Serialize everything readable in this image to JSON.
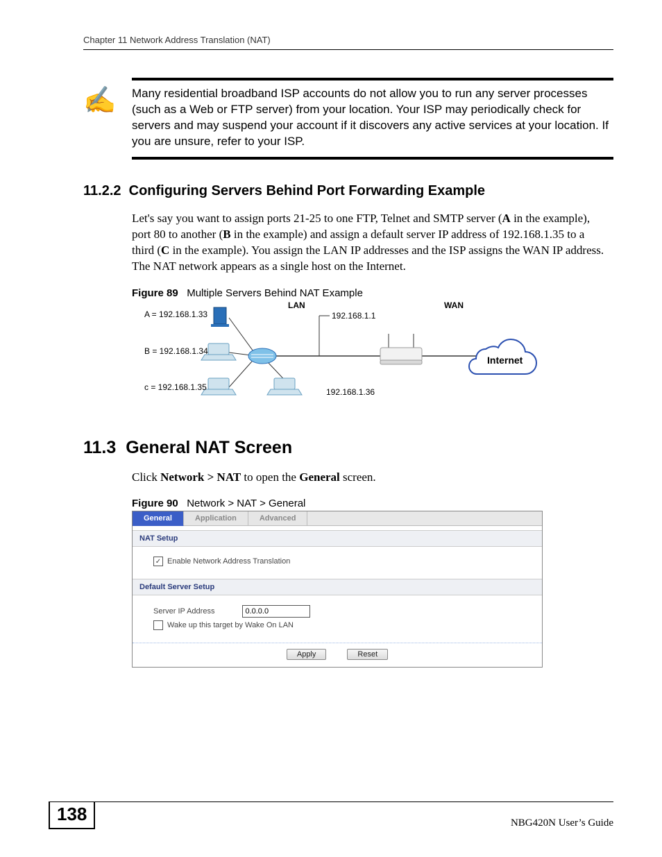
{
  "header": {
    "running_head": "Chapter 11 Network Address Translation (NAT)"
  },
  "note": {
    "icon": "✍",
    "text": "Many residential broadband ISP accounts do not allow you to run any server processes (such as a Web or FTP server) from your location. Your ISP may periodically check for servers and may suspend your account if it discovers any active services at your location. If you are unsure, refer to your ISP."
  },
  "section_1122": {
    "number": "11.2.2",
    "title": "Configuring Servers Behind Port Forwarding Example",
    "body_pre": "Let's say you want to assign ports 21-25 to one FTP, Telnet and SMTP server (",
    "A": "A",
    "body_mid1": " in the example), port 80 to another (",
    "B": "B",
    "body_mid2": " in the example) and assign a default server IP address of 192.168.1.35 to a third (",
    "C": "C",
    "body_end": " in the example). You assign the LAN IP addresses and the ISP assigns the WAN IP address. The NAT network appears as a single host on the Internet."
  },
  "figure89": {
    "label": "Figure 89",
    "caption": "Multiple Servers Behind NAT Example",
    "lan": "LAN",
    "wan": "WAN",
    "gateway_ip": "192.168.1.1",
    "router_ip": "192.168.1.36",
    "a_label": "A = 192.168.1.33",
    "b_label": "B = 192.168.1.34",
    "c_label": "c = 192.168.1.35",
    "internet": "Internet"
  },
  "section_113": {
    "number": "11.3",
    "title": "General NAT Screen",
    "body_pre": "Click ",
    "bold1": "Network > NAT",
    "body_mid": " to open the ",
    "bold2": "General",
    "body_end": " screen."
  },
  "figure90": {
    "label": "Figure 90",
    "caption": "Network > NAT > General"
  },
  "ui": {
    "tabs": {
      "general": "General",
      "application": "Application",
      "advanced": "Advanced"
    },
    "nat_setup_head": "NAT Setup",
    "enable_nat_label": "Enable Network Address Translation",
    "enable_nat_checked": "✓",
    "default_server_head": "Default Server Setup",
    "server_ip_label": "Server IP Address",
    "server_ip_value": "0.0.0.0",
    "wol_label": "Wake up this target by Wake On LAN",
    "apply": "Apply",
    "reset": "Reset"
  },
  "footer": {
    "page": "138",
    "guide": "NBG420N User’s Guide"
  }
}
